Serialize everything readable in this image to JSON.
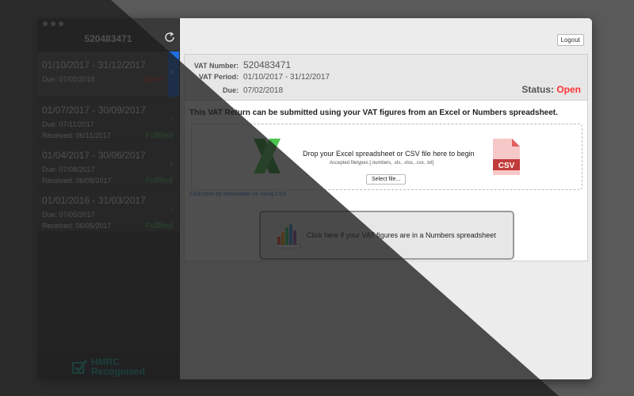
{
  "sidebar": {
    "vat_number_title": "520483471",
    "periods": [
      {
        "range": "01/10/2017 - 31/12/2017",
        "due": "Due: 07/02/2018",
        "received": "",
        "status": "Open"
      },
      {
        "range": "01/07/2017 - 30/09/2017",
        "due": "Due: 07/11/2017",
        "received": "Received: 06/11/2017",
        "status": "Fulfilled"
      },
      {
        "range": "01/04/2017 - 30/06/2017",
        "due": "Due: 07/08/2017",
        "received": "Received: 06/08/2017",
        "status": "Fulfilled"
      },
      {
        "range": "01/01/2016 - 31/03/2017",
        "due": "Due: 07/05/2017",
        "received": "Received: 06/05/2017",
        "status": "Fulfilled"
      }
    ],
    "badge_line1": "HMRC",
    "badge_line2": "Recognised"
  },
  "header": {
    "logout_label": "Logout"
  },
  "info": {
    "vat_number_label": "VAT Number:",
    "vat_number_value": "520483471",
    "vat_period_label": "VAT Period:",
    "vat_period_value": "01/10/2017 - 31/12/2017",
    "due_label": "Due:",
    "due_value": "07/02/2018",
    "status_label": "Status:",
    "status_value": "Open"
  },
  "main": {
    "instruction": "This VAT Return can be submitted using your VAT figures from an Excel or Numbers spreadsheet.",
    "drop_text": "Drop your Excel spreadsheet or CSV file here to begin",
    "filetypes": "Accepted filetypes [.numbers, .xls, .xlsx, .csv, .txt]",
    "select_file_label": "Select file...",
    "csv_link": "Click here for information on using CSV",
    "numbers_button_label": "Click here if your VAT figures are in a Numbers spreadsheet",
    "csv_icon_text": "CSV"
  },
  "colors": {
    "accent": "#1e6fe0",
    "open": "#ff3333",
    "fulfilled": "#4cd964",
    "hmrc": "#1ab5a5"
  }
}
